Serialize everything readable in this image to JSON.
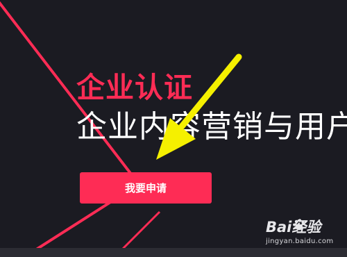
{
  "colors": {
    "background": "#1b1b22",
    "accent": "#fe2c55",
    "annotation_arrow": "#f5f000",
    "text": "#ffffff"
  },
  "hero": {
    "kicker": "企业认证",
    "headline": "企业内容营销与用户"
  },
  "cta": {
    "apply_label": "我要申请"
  },
  "watermark": {
    "logo": "Bai经验",
    "url": "jingyan.baidu.com"
  },
  "icons": {
    "annotation": "yellow-arrow-icon",
    "watermark": "baidu-paw-icon"
  }
}
